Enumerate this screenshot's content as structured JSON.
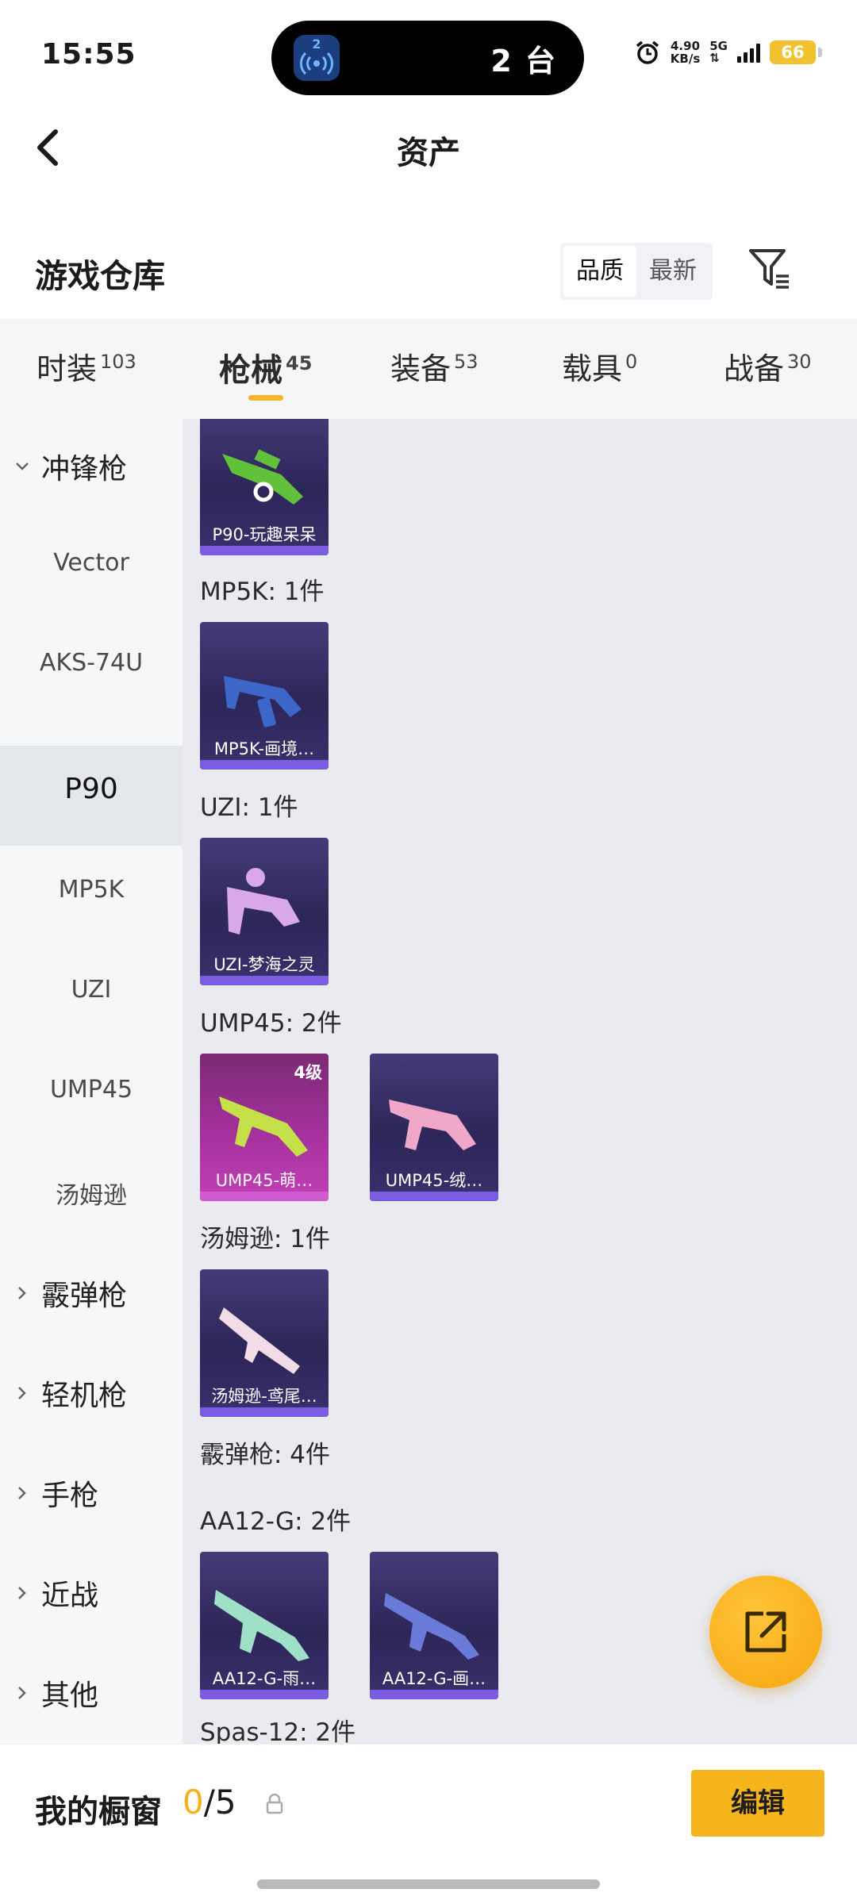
{
  "status_bar": {
    "time": "15:55",
    "island_badge": "2",
    "island_text": "2 台",
    "speed_value": "4.90",
    "speed_unit": "KB/s",
    "network": "5G",
    "battery": "66",
    "icons": [
      "alarm-icon",
      "signal-icon",
      "battery-icon"
    ]
  },
  "header": {
    "title": "资产",
    "back_icon": "back-arrow-icon"
  },
  "section": {
    "title": "游戏仓库",
    "sort_options": [
      "品质",
      "最新"
    ],
    "sort_selected": "品质",
    "filter_icon": "filter-icon"
  },
  "tabs": [
    {
      "label": "时装",
      "count": "103"
    },
    {
      "label": "枪械",
      "count": "45",
      "active": true
    },
    {
      "label": "装备",
      "count": "53"
    },
    {
      "label": "载具",
      "count": "0"
    },
    {
      "label": "战备",
      "count": "30"
    }
  ],
  "sidebar": [
    {
      "label": "冲锋枪",
      "type": "category",
      "expanded": true
    },
    {
      "label": "Vector",
      "type": "sub"
    },
    {
      "label": "AKS-74U",
      "type": "sub"
    },
    {
      "label": "P90",
      "type": "sub",
      "active": true
    },
    {
      "label": "MP5K",
      "type": "sub"
    },
    {
      "label": "UZI",
      "type": "sub"
    },
    {
      "label": "UMP45",
      "type": "sub"
    },
    {
      "label": "汤姆逊",
      "type": "sub"
    },
    {
      "label": "霰弹枪",
      "type": "category"
    },
    {
      "label": "轻机枪",
      "type": "category"
    },
    {
      "label": "手枪",
      "type": "category"
    },
    {
      "label": "近战",
      "type": "category"
    },
    {
      "label": "其他",
      "type": "category"
    }
  ],
  "content": {
    "groups": [
      "MP5K: 1件",
      "UZI: 1件",
      "UMP45: 2件",
      "汤姆逊: 1件",
      "霰弹枪: 4件",
      "AA12-G: 2件",
      "Spas-12: 2件"
    ],
    "items": [
      {
        "caption": "P90-玩趣呆呆",
        "color": "#62c13a"
      },
      {
        "caption": "MP5K-画境…",
        "color": "#3d66c9"
      },
      {
        "caption": "UZI-梦海之灵",
        "color": "#d8a8e8"
      },
      {
        "caption": "UMP45-萌…",
        "color": "#c6e04a",
        "level": "4级",
        "rarity": "pink"
      },
      {
        "caption": "UMP45-绒…",
        "color": "#f0a8c8"
      },
      {
        "caption": "汤姆逊-鸢尾…",
        "color": "#f2dce6"
      },
      {
        "caption": "AA12-G-雨…",
        "color": "#9ee0c8"
      },
      {
        "caption": "AA12-G-画…",
        "color": "#6a7ad8"
      }
    ]
  },
  "fab": {
    "icon": "share-icon"
  },
  "bottom_bar": {
    "title": "我的橱窗",
    "count_current": "0",
    "count_total": "/5",
    "lock_icon": "lock-icon",
    "edit_label": "编辑"
  }
}
